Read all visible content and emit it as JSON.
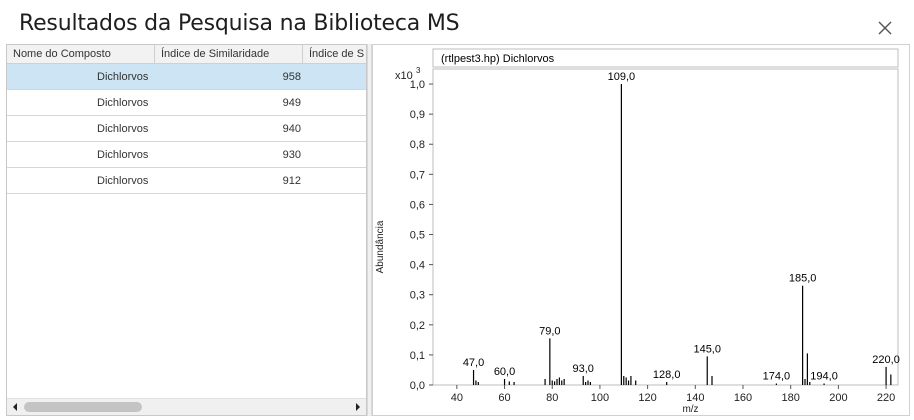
{
  "window": {
    "title": "Resultados da Pesquisa na Biblioteca MS",
    "close_icon": "close-icon"
  },
  "grid": {
    "columns": [
      "Nome do Composto",
      "Índice de Similaridade",
      "Índice de S"
    ],
    "rows": [
      {
        "name": "Dichlorvos",
        "similarity": "958",
        "selected": true
      },
      {
        "name": "Dichlorvos",
        "similarity": "949",
        "selected": false
      },
      {
        "name": "Dichlorvos",
        "similarity": "940",
        "selected": false
      },
      {
        "name": "Dichlorvos",
        "similarity": "930",
        "selected": false
      },
      {
        "name": "Dichlorvos",
        "similarity": "912",
        "selected": false
      }
    ],
    "scroll_left_icon": "chevron-left-icon",
    "scroll_right_icon": "chevron-right-icon"
  },
  "chart_data": {
    "type": "bar",
    "title": "(rtlpest3.hp) Dichlorvos",
    "xlabel": "m/z",
    "ylabel": "Abundância",
    "y_multiplier": "x10",
    "y_exponent": "3",
    "xlim": [
      30,
      225
    ],
    "ylim": [
      0,
      1.05
    ],
    "x_ticks": [
      "40",
      "60",
      "80",
      "100",
      "120",
      "140",
      "160",
      "180",
      "200",
      "220"
    ],
    "y_ticks": [
      "0,0",
      "0,1",
      "0,2",
      "0,3",
      "0,4",
      "0,5",
      "0,6",
      "0,7",
      "0,8",
      "0,9",
      "1,0"
    ],
    "peaks": [
      {
        "x": 47,
        "y": 0.05,
        "label": "47,0"
      },
      {
        "x": 48,
        "y": 0.015
      },
      {
        "x": 49,
        "y": 0.01
      },
      {
        "x": 60,
        "y": 0.02,
        "label": "60,0"
      },
      {
        "x": 62,
        "y": 0.012
      },
      {
        "x": 64,
        "y": 0.01
      },
      {
        "x": 77,
        "y": 0.02
      },
      {
        "x": 79,
        "y": 0.155,
        "label": "79,0"
      },
      {
        "x": 80,
        "y": 0.015
      },
      {
        "x": 81,
        "y": 0.012
      },
      {
        "x": 82,
        "y": 0.02
      },
      {
        "x": 83,
        "y": 0.025
      },
      {
        "x": 84,
        "y": 0.015
      },
      {
        "x": 85,
        "y": 0.02
      },
      {
        "x": 93,
        "y": 0.03,
        "label": "93,0"
      },
      {
        "x": 94,
        "y": 0.01
      },
      {
        "x": 95,
        "y": 0.015
      },
      {
        "x": 96,
        "y": 0.01
      },
      {
        "x": 109,
        "y": 1.0,
        "label": "109,0"
      },
      {
        "x": 110,
        "y": 0.03
      },
      {
        "x": 111,
        "y": 0.025
      },
      {
        "x": 112,
        "y": 0.015
      },
      {
        "x": 113,
        "y": 0.03
      },
      {
        "x": 115,
        "y": 0.015
      },
      {
        "x": 128,
        "y": 0.01,
        "label": "128,0"
      },
      {
        "x": 145,
        "y": 0.095,
        "label": "145,0"
      },
      {
        "x": 147,
        "y": 0.03
      },
      {
        "x": 174,
        "y": 0.005,
        "label": "174,0"
      },
      {
        "x": 185,
        "y": 0.33,
        "label": "185,0"
      },
      {
        "x": 186,
        "y": 0.02
      },
      {
        "x": 187,
        "y": 0.105
      },
      {
        "x": 188,
        "y": 0.01
      },
      {
        "x": 194,
        "y": 0.005,
        "label": "194,0"
      },
      {
        "x": 220,
        "y": 0.06,
        "label": "220,0"
      },
      {
        "x": 222,
        "y": 0.035
      }
    ]
  }
}
